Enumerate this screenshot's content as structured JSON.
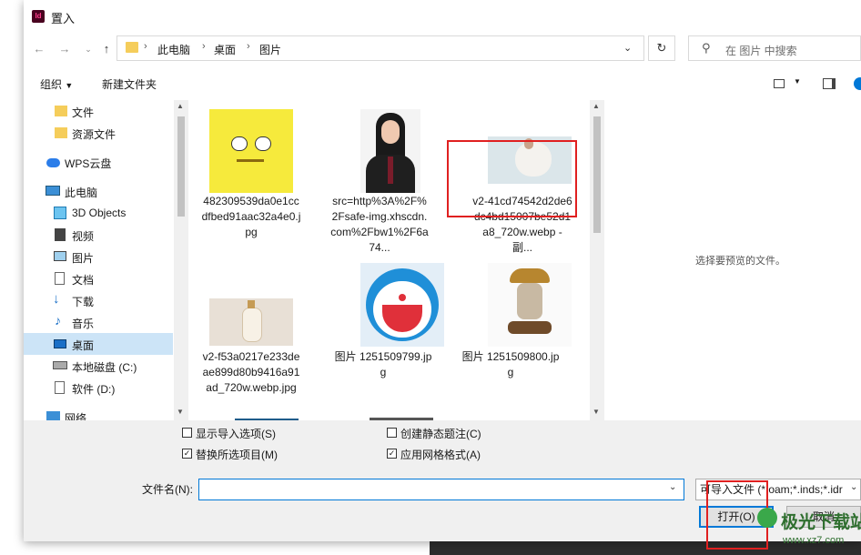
{
  "window": {
    "title": "置入",
    "app_icon": "Id"
  },
  "nav": {
    "breadcrumb": [
      "此电脑",
      "桌面",
      "图片"
    ],
    "search_placeholder": "在 图片 中搜索"
  },
  "toolbar": {
    "organize_label": "组织",
    "new_folder_label": "新建文件夹"
  },
  "sidebar": {
    "items": [
      {
        "label": "文件",
        "icon": "folder-icon"
      },
      {
        "label": "资源文件",
        "icon": "folder-icon"
      },
      {
        "label": "WPS云盘",
        "icon": "cloud-icon"
      },
      {
        "label": "此电脑",
        "icon": "computer-icon"
      },
      {
        "label": "3D Objects",
        "icon": "cube-icon"
      },
      {
        "label": "视频",
        "icon": "video-icon"
      },
      {
        "label": "图片",
        "icon": "picture-icon"
      },
      {
        "label": "文档",
        "icon": "document-icon"
      },
      {
        "label": "下载",
        "icon": "download-icon"
      },
      {
        "label": "音乐",
        "icon": "music-icon"
      },
      {
        "label": "桌面",
        "icon": "desktop-icon",
        "selected": true
      },
      {
        "label": "本地磁盘 (C:)",
        "icon": "drive-icon"
      },
      {
        "label": "软件 (D:)",
        "icon": "drive-icon"
      },
      {
        "label": "网络",
        "icon": "network-icon"
      }
    ]
  },
  "files": [
    {
      "caption": "482309539da0e1ccdfbed91aac32a4e0.jpg",
      "thumb": "spongebob"
    },
    {
      "caption": "src=http%3A%2F%2Fsafe-img.xhscdn.com%2Fbw1%2F6a74...",
      "thumb": "portrait"
    },
    {
      "caption": "v2-41cd74542d2de6dc4bd15007be52d1a8_720w.webp - 副...",
      "thumb": "dress"
    },
    {
      "caption": "v2-f53a0217e233deae899d80b9416a91ad_720w.webp.jpg",
      "thumb": "bottle"
    },
    {
      "caption": "图片 1251509799.jpg",
      "thumb": "doraemon"
    },
    {
      "caption": "图片 1251509800.jpg",
      "thumb": "burger-cat"
    }
  ],
  "preview": {
    "placeholder": "选择要预览的文件。"
  },
  "options": {
    "show_import_options": {
      "label": "显示导入选项(S)",
      "checked": false
    },
    "replace_selected": {
      "label": "替换所选项目(M)",
      "checked": true
    },
    "create_static_caption": {
      "label": "创建静态题注(C)",
      "checked": false
    },
    "apply_grid_format": {
      "label": "应用网格格式(A)",
      "checked": true
    }
  },
  "filename": {
    "label": "文件名(N):",
    "value": ""
  },
  "filetype": {
    "value": "可导入文件 (*.oam;*.inds;*.idr"
  },
  "buttons": {
    "open": "打开(O)",
    "cancel": "取消"
  },
  "watermark": {
    "text": "极光下载站",
    "url": "www.xz7.com"
  },
  "colors": {
    "accent": "#0078d7",
    "highlight": "#e02020",
    "selected_bg": "#cce4f7"
  }
}
